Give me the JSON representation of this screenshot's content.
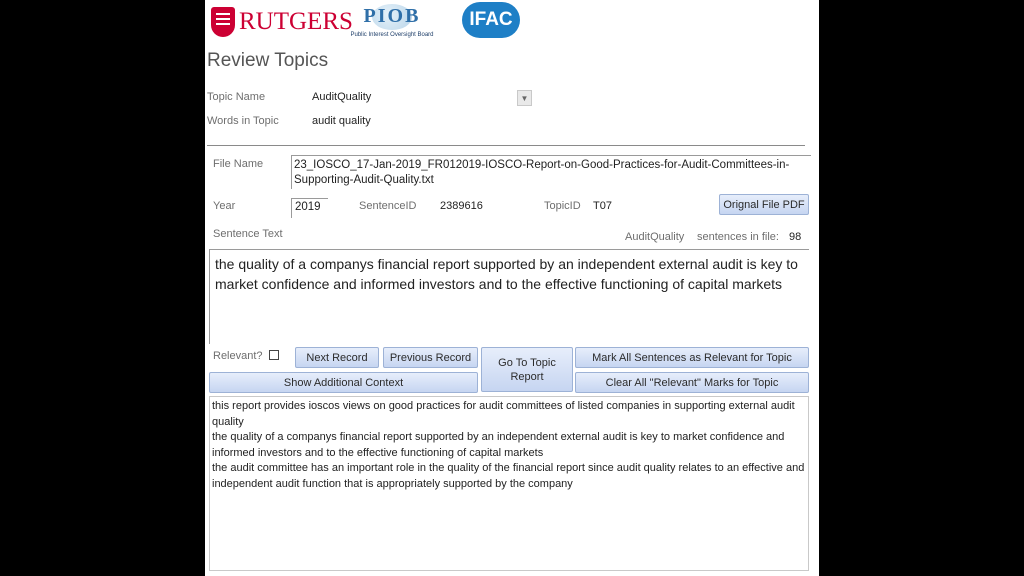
{
  "logos": {
    "rutgers": "RUTGERS",
    "piob": "PIOB",
    "piob_sub": "Public Interest Oversight Board",
    "ifac": "IFAC"
  },
  "title": "Review Topics",
  "topic_name": {
    "label": "Topic Name",
    "value": "AuditQuality"
  },
  "words_in_topic": {
    "label": "Words in Topic",
    "value": "audit quality"
  },
  "file_name": {
    "label": "File Name",
    "value": "23_IOSCO_17-Jan-2019_FR012019-IOSCO-Report-on-Good-Practices-for-Audit-Committees-in-Supporting-Audit-Quality.txt"
  },
  "year": {
    "label": "Year",
    "value": "2019"
  },
  "sentence_id": {
    "label": "SentenceID",
    "value": "2389616"
  },
  "topic_id": {
    "label": "TopicID",
    "value": "T07"
  },
  "buttons": {
    "original_pdf": "Orignal File PDF",
    "next_record": "Next Record",
    "previous_record": "Previous Record",
    "go_to_topic_report": "Go To Topic Report",
    "mark_all": "Mark All Sentences as Relevant for Topic",
    "show_context": "Show Additional Context",
    "clear_all": "Clear All \"Relevant\" Marks for Topic"
  },
  "sentence_text": {
    "label": "Sentence Text",
    "value": "the quality of a companys financial report supported by an independent external audit is key to market confidence and informed investors and to the effective functioning of capital markets"
  },
  "sentences_in_file": {
    "topic": "AuditQuality",
    "label": "sentences in file:",
    "count": "98"
  },
  "relevant": {
    "label": "Relevant?",
    "checked": false
  },
  "context": [
    "this report provides ioscos views on good practices for audit committees of listed companies in supporting external audit quality",
    "the quality of a companys financial report supported by an independent external audit is key to market confidence and informed investors and to the effective functioning of capital markets",
    "the audit committee has an important role in the quality of the financial report since audit quality relates to an effective and independent audit function that is appropriately supported by the company"
  ]
}
